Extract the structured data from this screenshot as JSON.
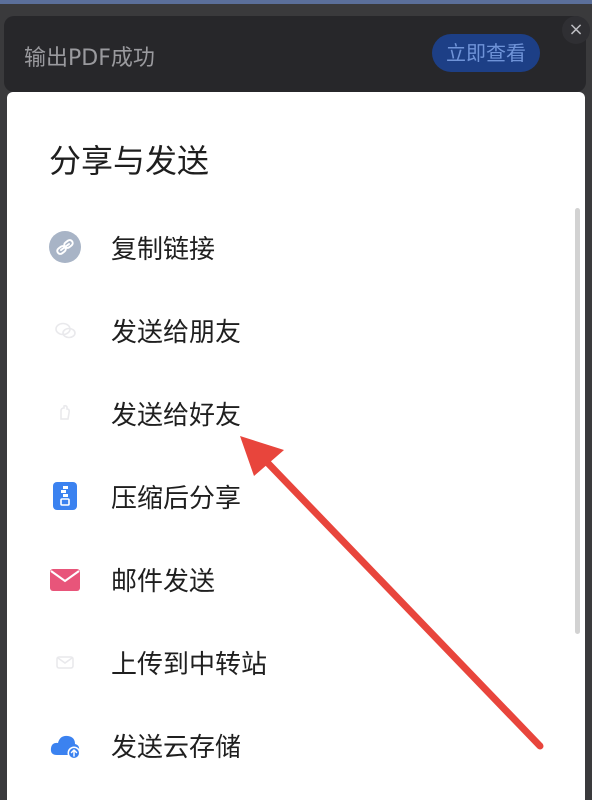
{
  "toast": {
    "message": "输出PDF成功",
    "view_button": "立即查看",
    "close_glyph": "×"
  },
  "share_sheet": {
    "title": "分享与发送",
    "items": [
      {
        "label": "复制链接",
        "icon": "link-icon"
      },
      {
        "label": "发送给朋友",
        "icon": "friend-icon"
      },
      {
        "label": "发送给好友",
        "icon": "contact-icon"
      },
      {
        "label": "压缩后分享",
        "icon": "zip-icon"
      },
      {
        "label": "邮件发送",
        "icon": "mail-icon"
      },
      {
        "label": "上传到中转站",
        "icon": "transfer-icon"
      },
      {
        "label": "发送云存储",
        "icon": "cloud-upload-icon"
      }
    ]
  },
  "colors": {
    "toast_bg": "#27272a",
    "view_button_bg": "#1d3f86",
    "annotation_arrow": "#e8453c",
    "mail_icon": "#e8557a",
    "zip_icon": "#3b82f0",
    "cloud_icon": "#3b82f0",
    "link_icon": "#a8b4c6"
  }
}
